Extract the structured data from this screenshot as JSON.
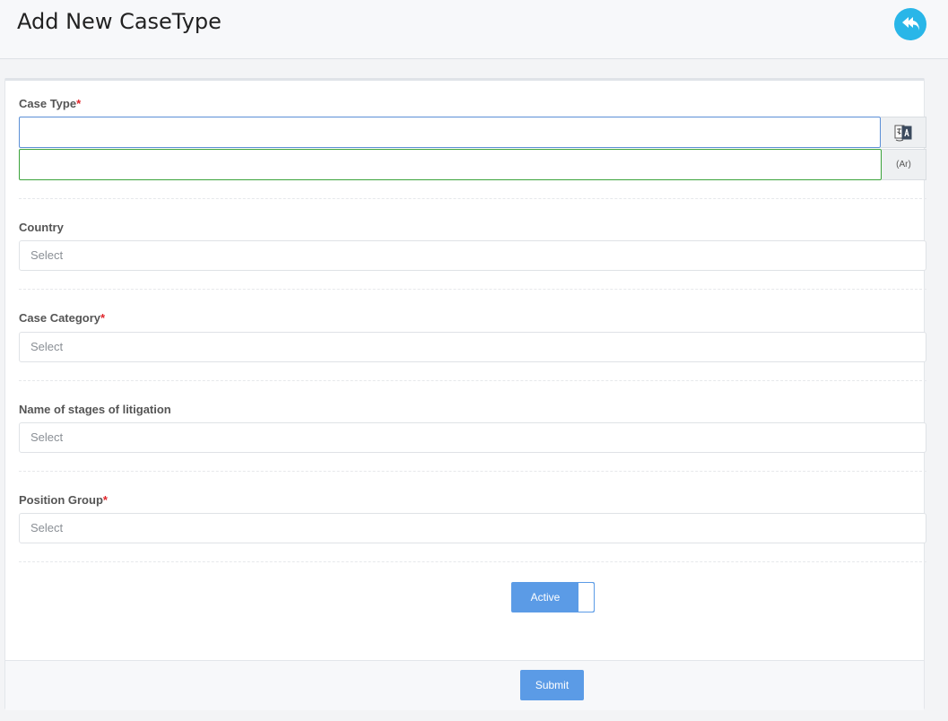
{
  "header": {
    "title": "Add New CaseType",
    "back_icon": "reply-all-icon"
  },
  "form": {
    "case_type": {
      "label": "Case Type",
      "required_mark": "*",
      "value_en": "",
      "value_ar": "",
      "translate_icon": "translate-icon",
      "ar_addon": "(Ar)"
    },
    "country": {
      "label": "Country",
      "placeholder": "Select"
    },
    "case_category": {
      "label": "Case Category",
      "required_mark": "*",
      "placeholder": "Select"
    },
    "stages": {
      "label": "Name of stages of litigation",
      "placeholder": "Select"
    },
    "position_group": {
      "label": "Position Group",
      "required_mark": "*",
      "placeholder": "Select"
    },
    "active_toggle": {
      "label": "Active",
      "on": true
    }
  },
  "footer": {
    "submit_label": "Submit"
  },
  "colors": {
    "accent": "#5b9be6",
    "back_button": "#29b6e8",
    "required": "#e0252b",
    "input_en_border": "#5b8fd6",
    "input_ar_border": "#3aa33a"
  }
}
